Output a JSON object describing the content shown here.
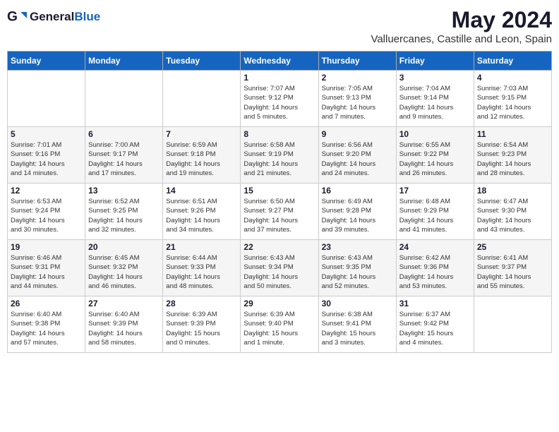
{
  "header": {
    "logo_general": "General",
    "logo_blue": "Blue",
    "month": "May 2024",
    "location": "Valluercanes, Castille and Leon, Spain"
  },
  "weekdays": [
    "Sunday",
    "Monday",
    "Tuesday",
    "Wednesday",
    "Thursday",
    "Friday",
    "Saturday"
  ],
  "weeks": [
    [
      {
        "day": "",
        "info": ""
      },
      {
        "day": "",
        "info": ""
      },
      {
        "day": "",
        "info": ""
      },
      {
        "day": "1",
        "info": "Sunrise: 7:07 AM\nSunset: 9:12 PM\nDaylight: 14 hours\nand 5 minutes."
      },
      {
        "day": "2",
        "info": "Sunrise: 7:05 AM\nSunset: 9:13 PM\nDaylight: 14 hours\nand 7 minutes."
      },
      {
        "day": "3",
        "info": "Sunrise: 7:04 AM\nSunset: 9:14 PM\nDaylight: 14 hours\nand 9 minutes."
      },
      {
        "day": "4",
        "info": "Sunrise: 7:03 AM\nSunset: 9:15 PM\nDaylight: 14 hours\nand 12 minutes."
      }
    ],
    [
      {
        "day": "5",
        "info": "Sunrise: 7:01 AM\nSunset: 9:16 PM\nDaylight: 14 hours\nand 14 minutes."
      },
      {
        "day": "6",
        "info": "Sunrise: 7:00 AM\nSunset: 9:17 PM\nDaylight: 14 hours\nand 17 minutes."
      },
      {
        "day": "7",
        "info": "Sunrise: 6:59 AM\nSunset: 9:18 PM\nDaylight: 14 hours\nand 19 minutes."
      },
      {
        "day": "8",
        "info": "Sunrise: 6:58 AM\nSunset: 9:19 PM\nDaylight: 14 hours\nand 21 minutes."
      },
      {
        "day": "9",
        "info": "Sunrise: 6:56 AM\nSunset: 9:20 PM\nDaylight: 14 hours\nand 24 minutes."
      },
      {
        "day": "10",
        "info": "Sunrise: 6:55 AM\nSunset: 9:22 PM\nDaylight: 14 hours\nand 26 minutes."
      },
      {
        "day": "11",
        "info": "Sunrise: 6:54 AM\nSunset: 9:23 PM\nDaylight: 14 hours\nand 28 minutes."
      }
    ],
    [
      {
        "day": "12",
        "info": "Sunrise: 6:53 AM\nSunset: 9:24 PM\nDaylight: 14 hours\nand 30 minutes."
      },
      {
        "day": "13",
        "info": "Sunrise: 6:52 AM\nSunset: 9:25 PM\nDaylight: 14 hours\nand 32 minutes."
      },
      {
        "day": "14",
        "info": "Sunrise: 6:51 AM\nSunset: 9:26 PM\nDaylight: 14 hours\nand 34 minutes."
      },
      {
        "day": "15",
        "info": "Sunrise: 6:50 AM\nSunset: 9:27 PM\nDaylight: 14 hours\nand 37 minutes."
      },
      {
        "day": "16",
        "info": "Sunrise: 6:49 AM\nSunset: 9:28 PM\nDaylight: 14 hours\nand 39 minutes."
      },
      {
        "day": "17",
        "info": "Sunrise: 6:48 AM\nSunset: 9:29 PM\nDaylight: 14 hours\nand 41 minutes."
      },
      {
        "day": "18",
        "info": "Sunrise: 6:47 AM\nSunset: 9:30 PM\nDaylight: 14 hours\nand 43 minutes."
      }
    ],
    [
      {
        "day": "19",
        "info": "Sunrise: 6:46 AM\nSunset: 9:31 PM\nDaylight: 14 hours\nand 44 minutes."
      },
      {
        "day": "20",
        "info": "Sunrise: 6:45 AM\nSunset: 9:32 PM\nDaylight: 14 hours\nand 46 minutes."
      },
      {
        "day": "21",
        "info": "Sunrise: 6:44 AM\nSunset: 9:33 PM\nDaylight: 14 hours\nand 48 minutes."
      },
      {
        "day": "22",
        "info": "Sunrise: 6:43 AM\nSunset: 9:34 PM\nDaylight: 14 hours\nand 50 minutes."
      },
      {
        "day": "23",
        "info": "Sunrise: 6:43 AM\nSunset: 9:35 PM\nDaylight: 14 hours\nand 52 minutes."
      },
      {
        "day": "24",
        "info": "Sunrise: 6:42 AM\nSunset: 9:36 PM\nDaylight: 14 hours\nand 53 minutes."
      },
      {
        "day": "25",
        "info": "Sunrise: 6:41 AM\nSunset: 9:37 PM\nDaylight: 14 hours\nand 55 minutes."
      }
    ],
    [
      {
        "day": "26",
        "info": "Sunrise: 6:40 AM\nSunset: 9:38 PM\nDaylight: 14 hours\nand 57 minutes."
      },
      {
        "day": "27",
        "info": "Sunrise: 6:40 AM\nSunset: 9:39 PM\nDaylight: 14 hours\nand 58 minutes."
      },
      {
        "day": "28",
        "info": "Sunrise: 6:39 AM\nSunset: 9:39 PM\nDaylight: 15 hours\nand 0 minutes."
      },
      {
        "day": "29",
        "info": "Sunrise: 6:39 AM\nSunset: 9:40 PM\nDaylight: 15 hours\nand 1 minute."
      },
      {
        "day": "30",
        "info": "Sunrise: 6:38 AM\nSunset: 9:41 PM\nDaylight: 15 hours\nand 3 minutes."
      },
      {
        "day": "31",
        "info": "Sunrise: 6:37 AM\nSunset: 9:42 PM\nDaylight: 15 hours\nand 4 minutes."
      },
      {
        "day": "",
        "info": ""
      }
    ]
  ]
}
